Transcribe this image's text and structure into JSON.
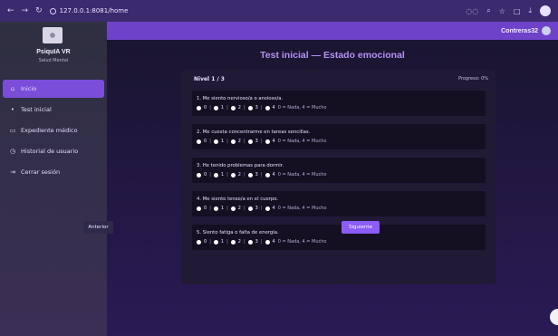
{
  "browser": {
    "url": "127.0.0.1:8081/home",
    "back": "←",
    "forward": "→",
    "reload": "↻",
    "actions": [
      "◌◌",
      "⌕",
      "☆",
      "□",
      "⤓"
    ]
  },
  "topbar": {
    "user": "Contreras32"
  },
  "sidebar": {
    "brand_title": "PsiquIA VR",
    "brand_sub": "Salud Mental",
    "items": [
      {
        "label": "Inicio",
        "icon": "⌂"
      },
      {
        "label": "Test inicial",
        "icon": "•"
      },
      {
        "label": "Expediente médico",
        "icon": "▭"
      },
      {
        "label": "Historial de usuario",
        "icon": "◷"
      },
      {
        "label": "Cerrar sesión",
        "icon": "⇥"
      }
    ]
  },
  "main": {
    "title": "Test inicial — Estado emocional",
    "level": "Nivel 1 / 3",
    "progress": "Progreso: 0%",
    "scale_hint": "0 = Nada, 4 = Mucho",
    "scale_values": [
      "0",
      "1",
      "2",
      "3",
      "4"
    ],
    "questions": [
      "1. Me siento nervioso/a o ansioso/a.",
      "2. Me cuesta concentrarme en tareas sencillas.",
      "3. He tenido problemas para dormir.",
      "4. Me siento tenso/a en el cuerpo.",
      "5. Siento fatiga o falta de energía."
    ],
    "prev_label": "Anterior",
    "next_label": "Siguiente"
  }
}
